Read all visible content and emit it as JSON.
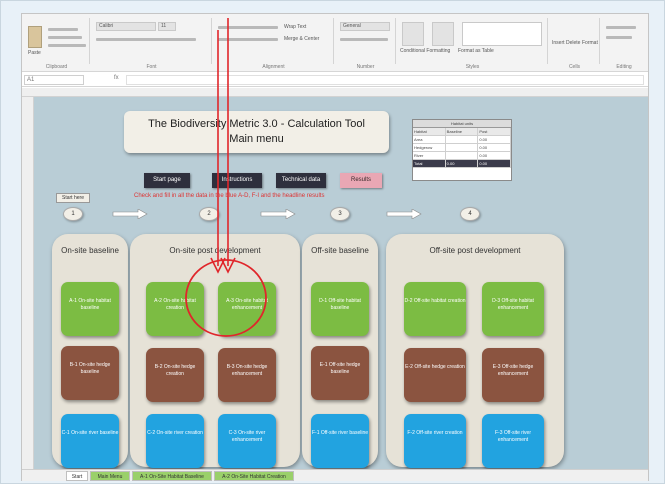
{
  "ribbon": {
    "paste_label": "Paste",
    "groups": [
      "Clipboard",
      "Font",
      "Alignment",
      "Number",
      "Styles",
      "Cells",
      "Editing"
    ],
    "font_name": "Calibri",
    "font_size": "11",
    "wrap_text": "Wrap Text",
    "merge_center": "Merge & Center",
    "general": "General",
    "conditional_formatting": "Conditional Formatting",
    "format_as_table": "Format as Table",
    "insert": "Insert",
    "delete": "Delete",
    "format": "Format"
  },
  "formula_bar": {
    "name_box": "A1",
    "fx": "fx"
  },
  "sheet": {
    "title_line1": "The Biodiversity Metric 3.0 - Calculation Tool",
    "title_line2": "Main menu",
    "nav_buttons": [
      "Start page",
      "Instructions",
      "Technical data",
      "Results"
    ],
    "red_note": "Check and fill in all the data in the blue A-D, F-I and the headline results",
    "start_chip": "Start here",
    "steps": [
      "1",
      "2",
      "3",
      "4"
    ],
    "mini_table": {
      "title": "Habitat units",
      "headers": [
        "Habitat",
        "Baseline",
        "Post"
      ],
      "rows": [
        [
          "Area",
          "",
          "0.00"
        ],
        [
          "Hedgerow",
          "",
          "0.00"
        ],
        [
          "River",
          "",
          "0.00"
        ],
        [
          "Total",
          "0.00",
          "0.00"
        ]
      ]
    },
    "panels": [
      {
        "title": "On-site baseline"
      },
      {
        "title": "On-site post development"
      },
      {
        "title": "Off-site baseline"
      },
      {
        "title": "Off-site post development"
      }
    ],
    "tiles": {
      "p1_green": "A-1 On-site habitat baseline",
      "p1_brown": "B-1 On-site hedge baseline",
      "p1_blue": "C-1 On-site river baseline",
      "p2_green1": "A-2 On-site habitat creation",
      "p2_green2": "A-3 On-site habitat enhancement",
      "p2_brown1": "B-2 On-site hedge creation",
      "p2_brown2": "B-3 On-site hedge enhancement",
      "p2_blue1": "C-2 On-site river creation",
      "p2_blue2": "C-3 On-site river enhancement",
      "p3_green": "D-1 Off-site habitat baseline",
      "p3_brown": "E-1 Off-site hedge baseline",
      "p3_blue": "F-1 Off-site river baseline",
      "p4_green1": "D-2 Off-site habitat creation",
      "p4_green2": "D-3 Off-site habitat enhancement",
      "p4_brown1": "E-2 Off-site hedge creation",
      "p4_brown2": "E-3 Off-site hedge enhancement",
      "p4_blue1": "F-2 Off-site river creation",
      "p4_blue2": "F-3 Off-site river enhancement"
    }
  },
  "tabs": [
    "Start",
    "Main Menu",
    "A-1 On-Site Habitat Baseline",
    "A-2 On-Site Habitat Creation"
  ],
  "colors": {
    "sheet_bg": "#b9cdd6",
    "panel_bg": "#e6e2d7",
    "green": "#7cbc43",
    "brown": "#8b5440",
    "blue": "#22a3e0",
    "annotation_red": "#e0262b"
  }
}
